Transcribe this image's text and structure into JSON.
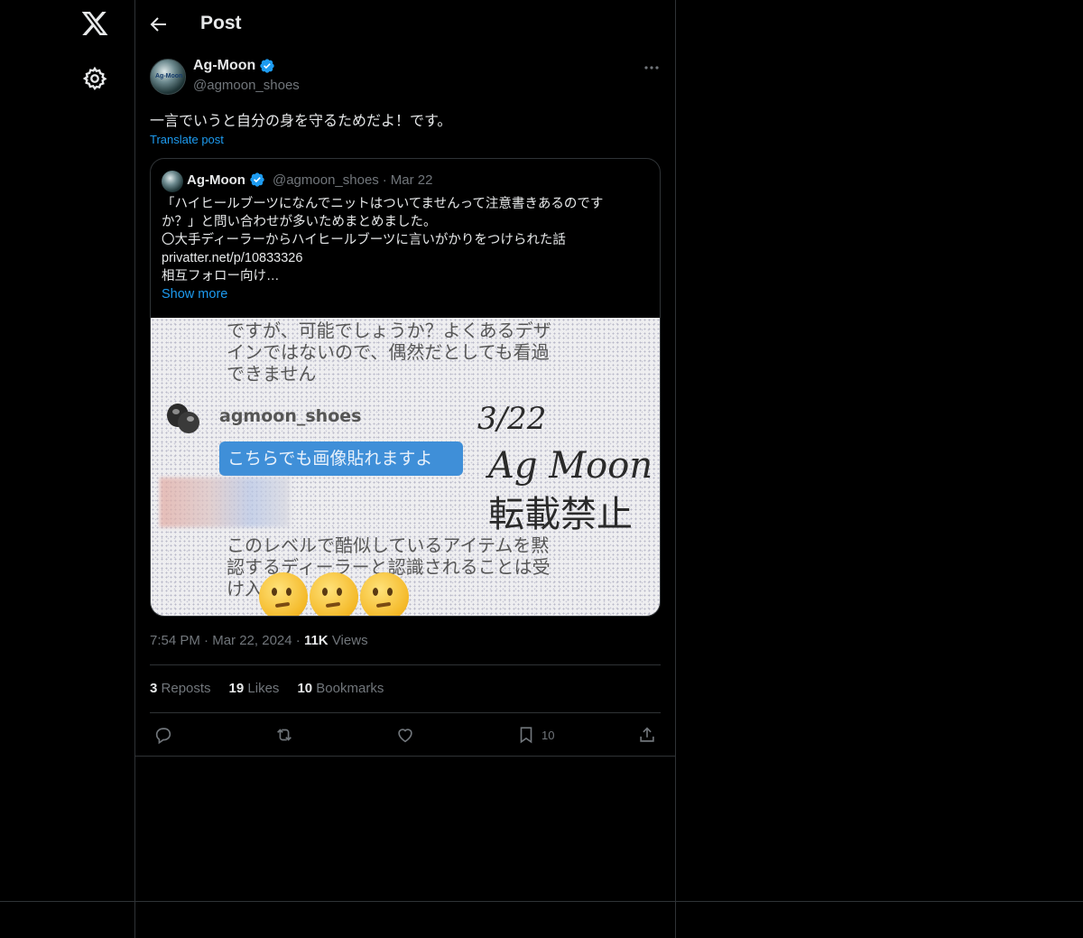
{
  "header": {
    "title": "Post"
  },
  "post": {
    "author": {
      "display_name": "Ag-Moon",
      "handle": "@agmoon_shoes",
      "avatar_text": "Ag-Moon"
    },
    "text": "一言でいうと自分の身を守るためだよ！です。",
    "translate_label": "Translate post",
    "quoted": {
      "display_name": "Ag-Moon",
      "handle": "@agmoon_shoes",
      "separator": "·",
      "date": "Mar 22",
      "lines": [
        "「ハイヒールブーツになんでニットはついてませんって注意書きあるのです",
        "か？」と問い合わせが多いためまとめました。",
        "〇大手ディーラーからハイヒールブーツに言いがかりをつけられた話",
        "privatter.net/p/10833326",
        "相互フォロー向け…"
      ],
      "show_more": "Show more",
      "image": {
        "text_top": [
          "ですが、可能でしょうか？よくあるデザ",
          "インではないので、偶然だとしても看過",
          "できません"
        ],
        "username": "agmoon_shoes",
        "bubble": "こちらでも画像貼れますよ",
        "text_bottom": [
          "このレベルで酷似しているアイテムを黙",
          "認するディーラーと認識されることは受",
          "け入"
        ],
        "sign_date": "3/22",
        "sign_name": "Ag Moon",
        "sign_note": "転載禁止"
      }
    },
    "time": "7:54 PM",
    "date": "Mar 22, 2024",
    "dot": "·",
    "views_count": "11K",
    "views_label": "Views",
    "stats": {
      "reposts_count": "3",
      "reposts_label": "Reposts",
      "likes_count": "19",
      "likes_label": "Likes",
      "bookmarks_count": "10",
      "bookmarks_label": "Bookmarks"
    },
    "actions": {
      "bookmark_count": "10"
    }
  },
  "colors": {
    "accent": "#1d9bf0",
    "background": "#000000",
    "border": "#2f3336",
    "muted": "#71767b"
  }
}
